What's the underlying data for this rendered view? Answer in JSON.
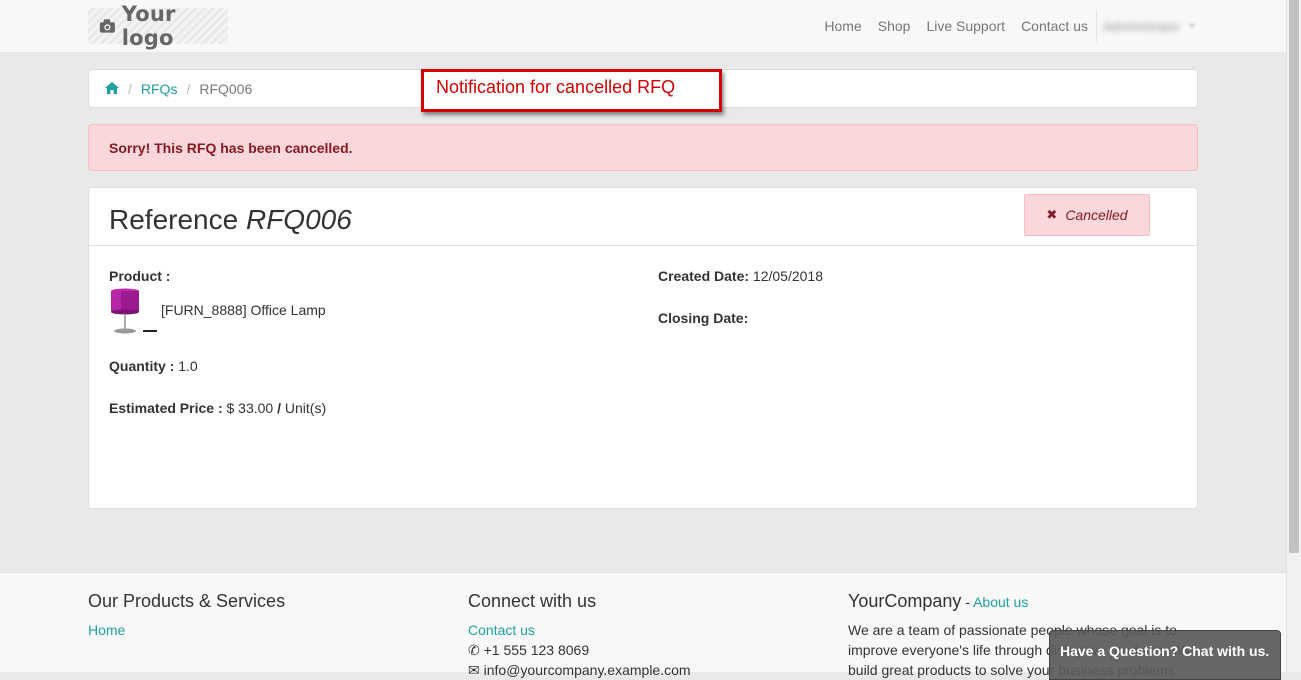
{
  "header": {
    "logo_text": "Your logo",
    "nav": [
      "Home",
      "Shop",
      "Live Support",
      "Contact us"
    ],
    "user_name": "Administrator"
  },
  "breadcrumb": {
    "items": [
      "RFQs"
    ],
    "current": "RFQ006"
  },
  "annotation": {
    "text": "Notification for cancelled RFQ",
    "color": "#d40000"
  },
  "alert": {
    "text": "Sorry! This RFQ has been cancelled."
  },
  "rfq": {
    "title_prefix": "Reference",
    "reference": "RFQ006",
    "status_label": "Cancelled",
    "product_label": "Product :",
    "product_name": "[FURN_8888] Office Lamp",
    "quantity_label": "Quantity :",
    "quantity": "1.0",
    "price_label": "Estimated Price :",
    "price": "$ 33.00",
    "price_sep": "/",
    "unit": "Unit(s)",
    "created_label": "Created Date:",
    "created_date": "12/05/2018",
    "closing_label": "Closing Date:",
    "closing_date": ""
  },
  "footer": {
    "col1_title": "Our Products & Services",
    "col1_link": "Home",
    "col2_title": "Connect with us",
    "col2_link": "Contact us",
    "phone": "+1 555 123 8069",
    "email": "info@yourcompany.example.com",
    "col3_company": "YourCompany",
    "col3_dash": " - ",
    "col3_link": "About us",
    "col3_text": "We are a team of passionate people whose goal is to improve everyone's life through disruptive products. We build great products to solve your business problems."
  },
  "chat": {
    "text": "Have a Question? Chat with us."
  },
  "colors": {
    "accent": "#21a0a0",
    "alert_bg": "#f9d7da",
    "alert_text": "#861b23"
  }
}
